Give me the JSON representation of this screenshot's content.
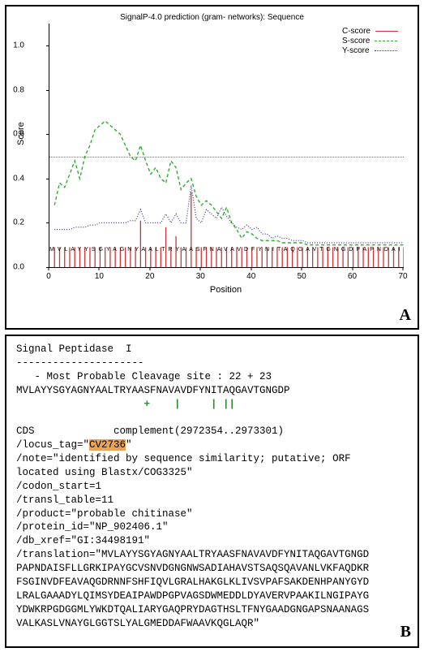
{
  "panelA_label": "A",
  "panelB_label": "B",
  "chart_data": {
    "type": "line",
    "title": "SignalP-4.0 prediction (gram- networks): Sequence",
    "xlabel": "Position",
    "ylabel": "Score",
    "xlim": [
      0,
      70
    ],
    "ylim": [
      0,
      1.1
    ],
    "yticks": [
      0.0,
      0.2,
      0.4,
      0.6,
      0.8,
      1.0
    ],
    "xticks": [
      0,
      10,
      20,
      30,
      40,
      50,
      60,
      70
    ],
    "threshold": 0.5,
    "sequence_band": "MVLAYYSGYAGNYAALTRYAASFNAVAVDFYNITAQGAVTGNGDPAPNDAISFLLGRKIPAYGCVSNVDG",
    "legend": [
      {
        "name": "C-score",
        "style": "solid",
        "color": "#cc3333"
      },
      {
        "name": "S-score",
        "style": "dashed",
        "color": "#33aa33"
      },
      {
        "name": "Y-score",
        "style": "dotted",
        "color": "#333388"
      }
    ],
    "series": [
      {
        "name": "C-score",
        "x": [
          1,
          2,
          3,
          4,
          5,
          6,
          7,
          8,
          9,
          10,
          11,
          12,
          13,
          14,
          15,
          16,
          17,
          18,
          19,
          20,
          21,
          22,
          23,
          24,
          25,
          26,
          27,
          28,
          29,
          30,
          31,
          32,
          33,
          34,
          35,
          36,
          37,
          38,
          39,
          40,
          41,
          42,
          43,
          44,
          45,
          46,
          47,
          48,
          49,
          50,
          51,
          52,
          53,
          54,
          55,
          56,
          57,
          58,
          59,
          60,
          61,
          62,
          63,
          64,
          65,
          66,
          67,
          68,
          69,
          70
        ],
        "values": [
          0.09,
          0.09,
          0.09,
          0.09,
          0.09,
          0.09,
          0.09,
          0.09,
          0.09,
          0.09,
          0.09,
          0.09,
          0.09,
          0.09,
          0.09,
          0.09,
          0.09,
          0.21,
          0.09,
          0.09,
          0.09,
          0.09,
          0.18,
          0.09,
          0.14,
          0.09,
          0.09,
          0.34,
          0.09,
          0.09,
          0.09,
          0.09,
          0.09,
          0.09,
          0.09,
          0.09,
          0.09,
          0.09,
          0.09,
          0.09,
          0.09,
          0.09,
          0.09,
          0.09,
          0.09,
          0.09,
          0.09,
          0.09,
          0.09,
          0.09,
          0.09,
          0.09,
          0.09,
          0.09,
          0.09,
          0.09,
          0.09,
          0.09,
          0.09,
          0.09,
          0.09,
          0.09,
          0.09,
          0.09,
          0.09,
          0.09,
          0.09,
          0.09,
          0.09,
          0.09
        ]
      },
      {
        "name": "S-score",
        "x": [
          1,
          2,
          3,
          4,
          5,
          6,
          7,
          8,
          9,
          10,
          11,
          12,
          13,
          14,
          15,
          16,
          17,
          18,
          19,
          20,
          21,
          22,
          23,
          24,
          25,
          26,
          27,
          28,
          29,
          30,
          31,
          32,
          33,
          34,
          35,
          36,
          37,
          38,
          39,
          40,
          41,
          42,
          43,
          44,
          45,
          46,
          47,
          48,
          49,
          50,
          51,
          52,
          53,
          54,
          55,
          56,
          57,
          58,
          59,
          60,
          61,
          62,
          63,
          64,
          65,
          66,
          67,
          68,
          69,
          70
        ],
        "values": [
          0.28,
          0.38,
          0.36,
          0.42,
          0.48,
          0.4,
          0.5,
          0.55,
          0.62,
          0.64,
          0.66,
          0.64,
          0.62,
          0.6,
          0.55,
          0.5,
          0.48,
          0.55,
          0.48,
          0.42,
          0.45,
          0.4,
          0.38,
          0.48,
          0.45,
          0.35,
          0.38,
          0.4,
          0.32,
          0.28,
          0.3,
          0.28,
          0.25,
          0.22,
          0.27,
          0.2,
          0.17,
          0.13,
          0.16,
          0.15,
          0.13,
          0.12,
          0.12,
          0.12,
          0.12,
          0.11,
          0.11,
          0.11,
          0.11,
          0.11,
          0.1,
          0.1,
          0.1,
          0.1,
          0.1,
          0.1,
          0.1,
          0.1,
          0.1,
          0.1,
          0.1,
          0.1,
          0.1,
          0.1,
          0.1,
          0.1,
          0.1,
          0.1,
          0.1,
          0.1
        ]
      },
      {
        "name": "Y-score",
        "x": [
          1,
          2,
          3,
          4,
          5,
          6,
          7,
          8,
          9,
          10,
          11,
          12,
          13,
          14,
          15,
          16,
          17,
          18,
          19,
          20,
          21,
          22,
          23,
          24,
          25,
          26,
          27,
          28,
          29,
          30,
          31,
          32,
          33,
          34,
          35,
          36,
          37,
          38,
          39,
          40,
          41,
          42,
          43,
          44,
          45,
          46,
          47,
          48,
          49,
          50,
          51,
          52,
          53,
          54,
          55,
          56,
          57,
          58,
          59,
          60,
          61,
          62,
          63,
          64,
          65,
          66,
          67,
          68,
          69,
          70
        ],
        "values": [
          0.17,
          0.17,
          0.17,
          0.17,
          0.18,
          0.18,
          0.18,
          0.19,
          0.19,
          0.2,
          0.2,
          0.2,
          0.2,
          0.2,
          0.2,
          0.21,
          0.21,
          0.26,
          0.2,
          0.2,
          0.2,
          0.2,
          0.24,
          0.2,
          0.24,
          0.2,
          0.2,
          0.37,
          0.22,
          0.2,
          0.26,
          0.24,
          0.22,
          0.27,
          0.23,
          0.2,
          0.18,
          0.17,
          0.19,
          0.17,
          0.18,
          0.15,
          0.15,
          0.13,
          0.14,
          0.13,
          0.13,
          0.12,
          0.12,
          0.12,
          0.11,
          0.11,
          0.11,
          0.11,
          0.11,
          0.11,
          0.11,
          0.11,
          0.11,
          0.11,
          0.11,
          0.11,
          0.11,
          0.11,
          0.11,
          0.11,
          0.11,
          0.11,
          0.11,
          0.11
        ]
      }
    ]
  },
  "signal_peptidase": {
    "header": "Signal Peptidase  I",
    "divider": "---------------------",
    "cleavage_line": "   - Most Probable Cleavage site : 22 + 23",
    "peptide_seq": "MVLAYYSGYAGNYAALTRYAASFNAVAVDFYNITAQGAVTGNGDP",
    "marks": "                     +    |     | ||"
  },
  "cds": {
    "line": "CDS             complement(2972354..2973301)",
    "locus_tag_prefix": "/locus_tag=\"",
    "locus_tag_value": "CV2736",
    "locus_tag_suffix": "\"",
    "note1": "/note=\"identified by sequence similarity; putative; ORF",
    "note2": "located using Blastx/COG3325\"",
    "codon_start": "/codon_start=1",
    "transl_table": "/transl_table=11",
    "product": "/product=\"probable chitinase\"",
    "protein_id": "/protein_id=\"NP_902406.1\"",
    "db_xref": "/db_xref=\"GI:34498191\"",
    "translation_lines": [
      "/translation=\"MVLAYYSGYAGNYAALTRYAASFNAVAVDFYNITAQGAVTGNGD",
      "PAPNDAISFLLGRKIPAYGCVSNVDGNGNWSADIAHAVSTSAQSQAVANLVKFAQDKR",
      "FSGINVDFEAVAQGDRNNFSHFIQVLGRALHAKGLKLIVSVPAFSAKDENHPANYGYD",
      "LRALGAAADYLQIMSYDEAIPAWDPGPVAGSDWMEDDLDYAVERVPAAKILNGIPAYG",
      "YDWKRPGDGGMLYWKDTQALIARYGAQPRYDAGTHSLTFNYGAADGNGAPSNAANAGS",
      "VALKASLVNAYGLGGTSLYALGMEDDAFWAAVKQGLAQR\""
    ]
  }
}
